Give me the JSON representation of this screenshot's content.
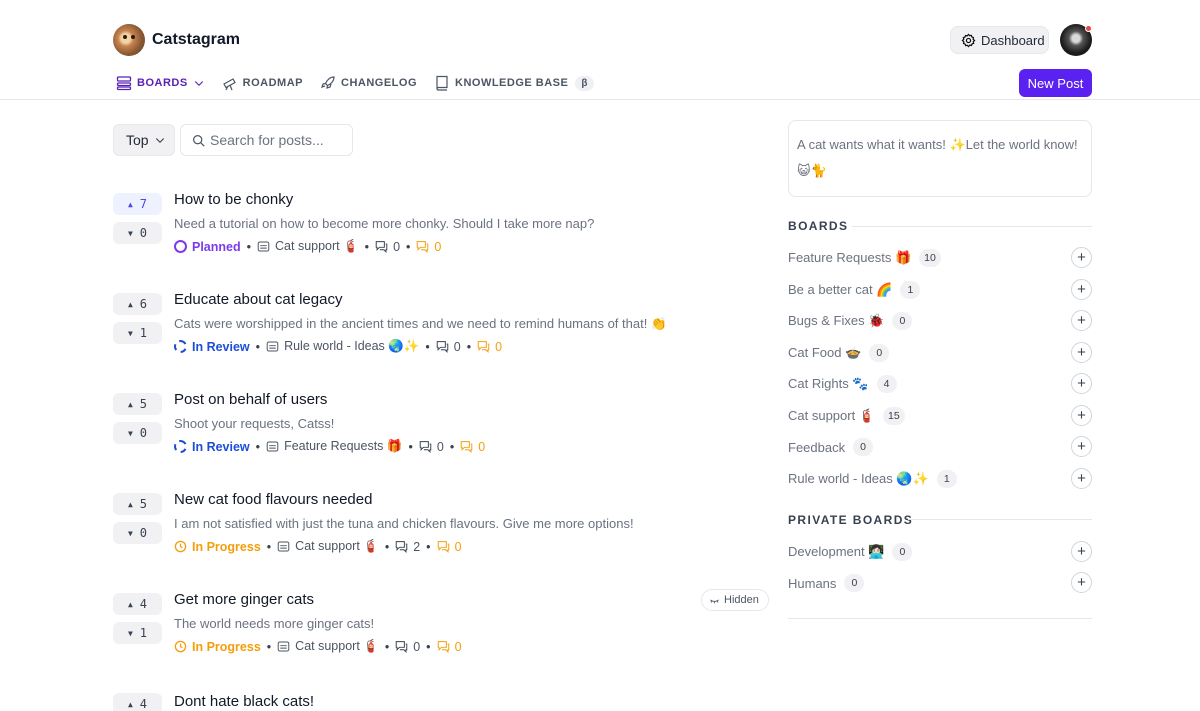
{
  "app": {
    "name": "Catstagram"
  },
  "header": {
    "dashboard_label": "Dashboard",
    "new_post_label": "New Post",
    "nav": [
      {
        "label": "BOARDS",
        "icon": "boards-icon"
      },
      {
        "label": "ROADMAP",
        "icon": "telescope-icon"
      },
      {
        "label": "CHANGELOG",
        "icon": "rocket-icon"
      },
      {
        "label": "KNOWLEDGE BASE",
        "icon": "book-icon",
        "badge": "β"
      }
    ]
  },
  "toolbar": {
    "sort_label": "Top",
    "search_placeholder": "Search for posts..."
  },
  "posts": [
    {
      "title": "How to be chonky",
      "desc": "Need a tutorial on how to become more chonky. Should I take more nap?",
      "up": 7,
      "down": 0,
      "status": "Planned",
      "status_color": "#7c3aed",
      "board": "Cat support 🧯",
      "comments": 0,
      "pending": 0
    },
    {
      "title": "Educate about cat legacy",
      "desc": "Cats were worshipped in the ancient times and we need to remind humans of that! 👏",
      "up": 6,
      "down": 1,
      "status": "In Review",
      "status_color": "#1d4ed8",
      "board": "Rule world - Ideas 🌏✨",
      "comments": 0,
      "pending": 0
    },
    {
      "title": "Post on behalf of users",
      "desc": "Shoot your requests, Catss!",
      "up": 5,
      "down": 0,
      "status": "In Review",
      "status_color": "#1d4ed8",
      "board": "Feature Requests 🎁",
      "comments": 0,
      "pending": 0
    },
    {
      "title": "New cat food flavours needed",
      "desc": "I am not satisfied with just the tuna and chicken flavours. Give me more options!",
      "up": 5,
      "down": 0,
      "status": "In Progress",
      "status_color": "#f59e0b",
      "board": "Cat support 🧯",
      "comments": 2,
      "pending": 0
    },
    {
      "title": "Get more ginger cats",
      "desc": "The world needs more ginger cats!",
      "up": 4,
      "down": 1,
      "status": "In Progress",
      "status_color": "#f59e0b",
      "board": "Cat support 🧯",
      "comments": 0,
      "pending": 0,
      "badge": "Hidden"
    },
    {
      "title": "Dont hate black cats!",
      "up": 4
    }
  ],
  "composer": {
    "text": "A cat wants what it wants! ✨Let the world know! 😺🐈"
  },
  "boards_section": {
    "title": "BOARDS",
    "items": [
      {
        "name": "Feature Requests 🎁",
        "count": 10
      },
      {
        "name": "Be a better cat 🌈",
        "count": 1
      },
      {
        "name": "Bugs & Fixes 🐞",
        "count": 0
      },
      {
        "name": "Cat Food 🍲",
        "count": 0
      },
      {
        "name": "Cat Rights 🐾",
        "count": 4
      },
      {
        "name": "Cat support 🧯",
        "count": 15
      },
      {
        "name": "Feedback",
        "count": 0
      },
      {
        "name": "Rule world - Ideas 🌏✨",
        "count": 1
      }
    ]
  },
  "private_section": {
    "title": "PRIVATE BOARDS",
    "items": [
      {
        "name": "Development 👩🏻‍💻",
        "count": 0
      },
      {
        "name": "Humans",
        "count": 0
      }
    ]
  },
  "colors": {
    "accent": "#5b21f0",
    "planned": "#7c3aed",
    "review": "#1d4ed8",
    "progress": "#f59e0b"
  }
}
